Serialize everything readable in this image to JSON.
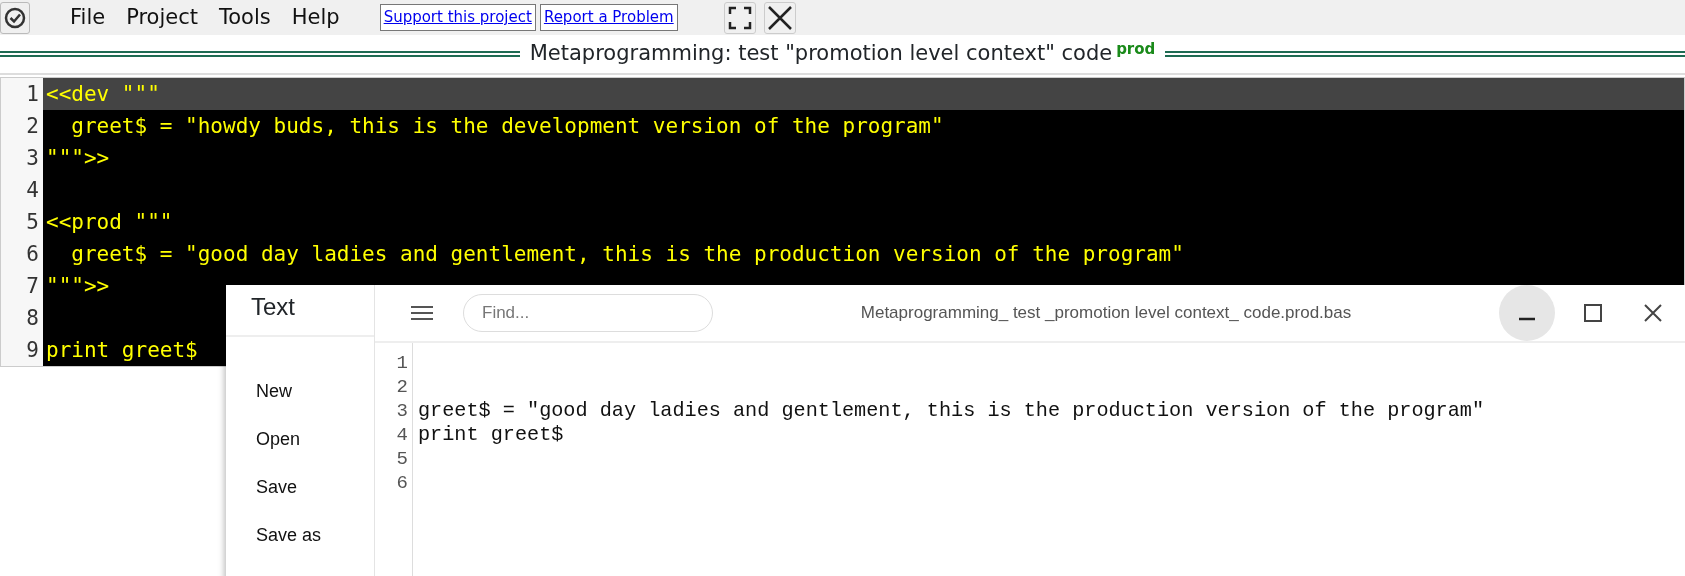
{
  "menu_bar": {
    "menus": [
      "File",
      "Project",
      "Tools",
      "Help"
    ],
    "links": [
      "Support this project",
      "Report a Problem"
    ]
  },
  "title_bar": {
    "title": "Metaprogramming: test \"promotion level context\" code",
    "level_tag": "prod"
  },
  "editor": {
    "lines": [
      {
        "number": "1",
        "text": "<<dev \"\"\"",
        "current": true
      },
      {
        "number": "2",
        "text": "  greet$ = \"howdy buds, this is the development version of the program\"",
        "current": false
      },
      {
        "number": "3",
        "text": "\"\"\">>",
        "current": false
      },
      {
        "number": "4",
        "current": false
      },
      {
        "number": "5",
        "text": "<<prod \"\"\"",
        "current": false
      },
      {
        "number": "6",
        "text": "  greet$ = \"good day ladies and gentlement, this is the production version of the program\"",
        "current": false
      },
      {
        "number": "7",
        "text": "\"\"\">>",
        "current": false
      },
      {
        "number": "8",
        "current": false
      },
      {
        "number": "9",
        "text": "print greet$",
        "current": false
      }
    ]
  },
  "text_window": {
    "app_title": "Text",
    "menu_items": [
      "New",
      "Open",
      "Save",
      "Save as"
    ],
    "search": {
      "placeholder": "Find..."
    },
    "file_name": "Metaprogramming_ test _promotion level context_ code.prod.bas",
    "lines": [
      {
        "number": "1"
      },
      {
        "number": "2"
      },
      {
        "number": "3",
        "text": "greet$ = \"good day ladies and gentlement, this is the production version of the program\""
      },
      {
        "number": "4",
        "text": "print greet$"
      },
      {
        "number": "5"
      },
      {
        "number": "6"
      }
    ]
  }
}
